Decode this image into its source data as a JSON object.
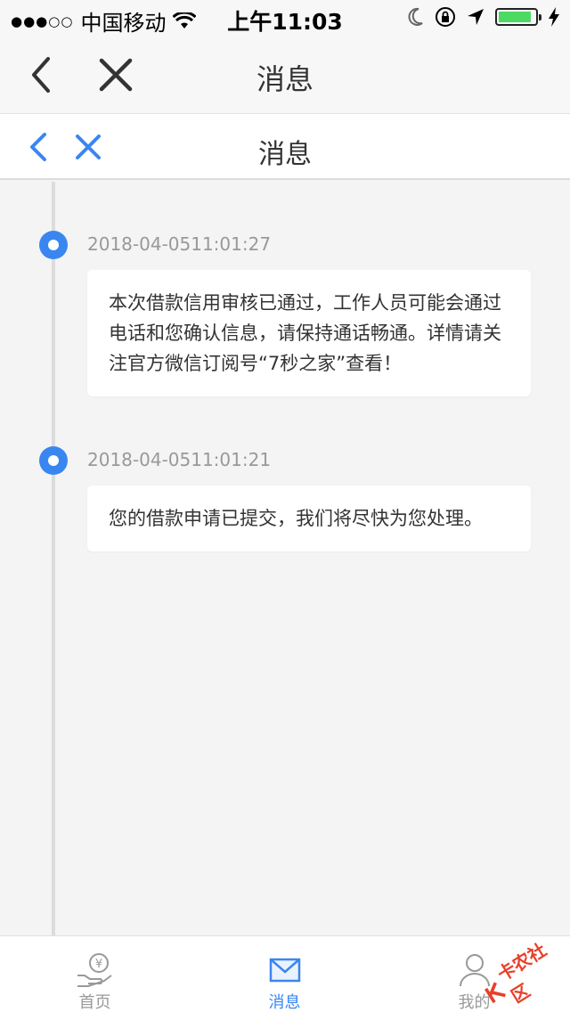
{
  "status_bar": {
    "signal_dots": "●●●○○",
    "carrier": "中国移动",
    "time": "上午11:03",
    "icons": [
      "wifi-icon",
      "moon-icon",
      "orientation-lock-icon",
      "location-arrow-icon",
      "battery-icon",
      "charging-bolt-icon"
    ],
    "battery_level": 0.9
  },
  "outer_nav": {
    "title": "消息",
    "icons": [
      "back-chevron-icon",
      "close-x-icon"
    ]
  },
  "inner_nav": {
    "title": "消息",
    "icons": [
      "back-chevron-icon",
      "close-x-icon"
    ],
    "accent": "#3a86f0"
  },
  "messages": [
    {
      "timestamp": "2018-04-0511:01:27",
      "text": "本次借款信用审核已通过，工作人员可能会通过电话和您确认信息，请保持通话畅通。详情请关注官方微信订阅号“7秒之家”查看！"
    },
    {
      "timestamp": "2018-04-0511:01:21",
      "text": "您的借款申请已提交，我们将尽快为您处理。"
    }
  ],
  "tab_bar": {
    "tabs": [
      {
        "label": "首页",
        "icon": "hand-coin-icon",
        "active": false
      },
      {
        "label": "消息",
        "icon": "envelope-icon",
        "active": true
      },
      {
        "label": "我的",
        "icon": "person-icon",
        "active": false
      }
    ],
    "active_color": "#3a86f0",
    "inactive_color": "#999999"
  },
  "watermark": {
    "text": "卡农社区"
  }
}
